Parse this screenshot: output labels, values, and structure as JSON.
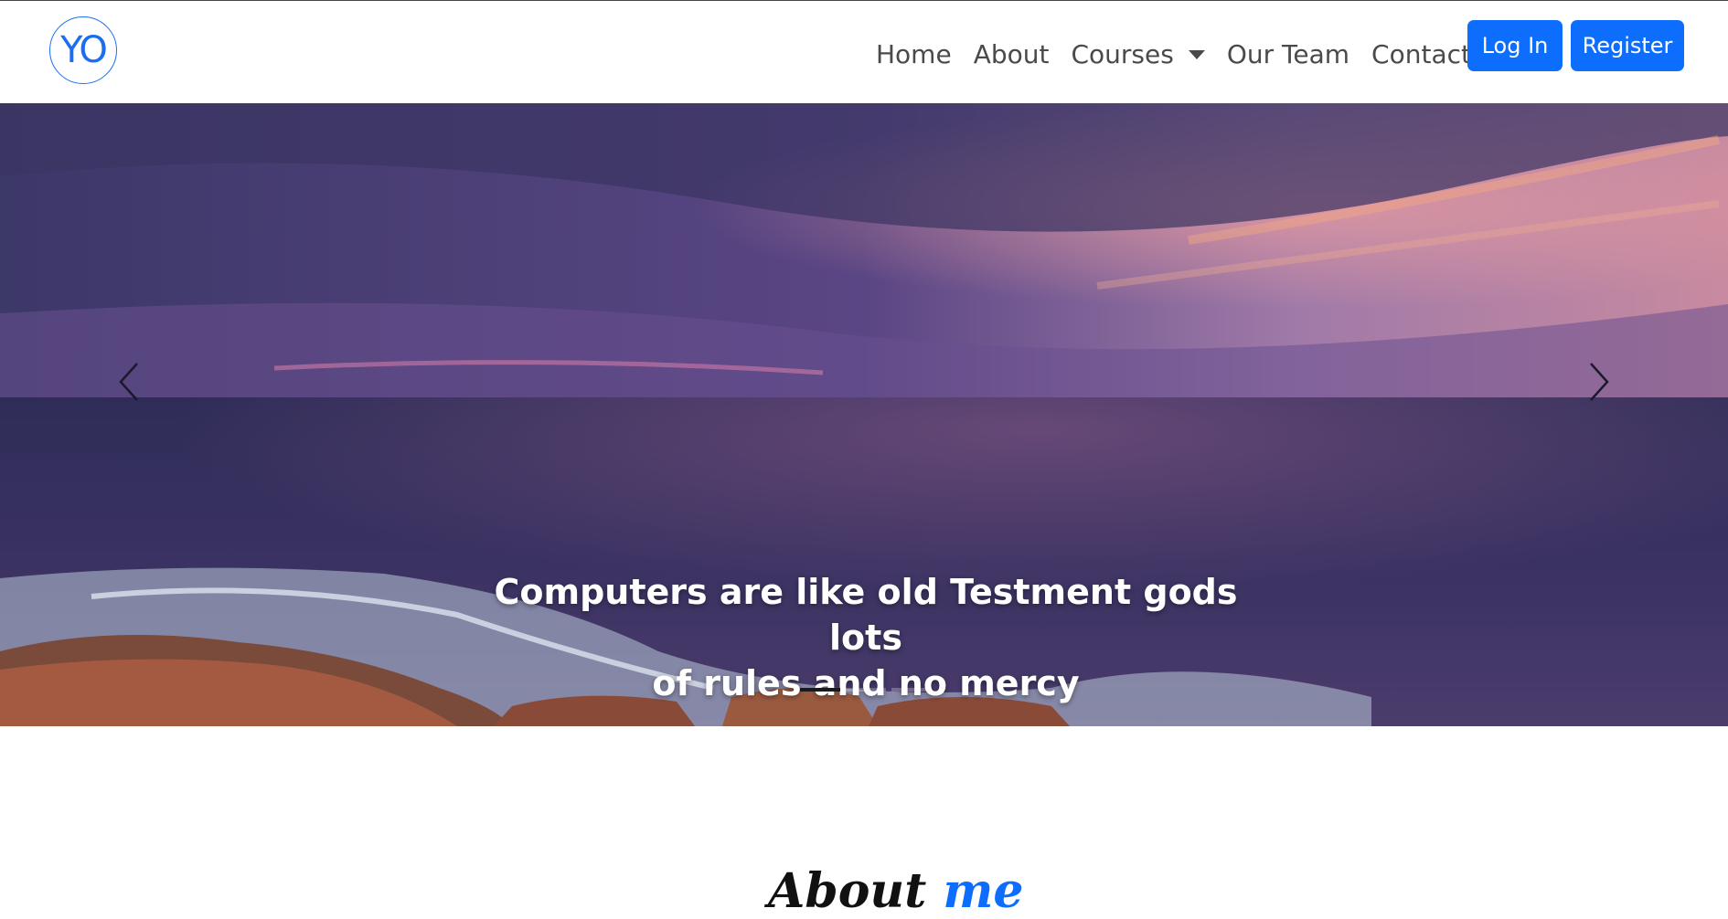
{
  "logo": {
    "text": "YO"
  },
  "nav": {
    "items": [
      {
        "label": "Home"
      },
      {
        "label": "About"
      },
      {
        "label": "Courses"
      },
      {
        "label": "Our Team"
      },
      {
        "label": "Contact"
      }
    ],
    "login_label": "Log In",
    "register_label": "Register"
  },
  "hero": {
    "caption_line1": "Computers are like old Testment gods lots",
    "caption_line2": "of rules and no mercy",
    "prev_icon": "chevron-left-icon",
    "next_icon": "chevron-right-icon",
    "slides_count": 3,
    "active_slide": 0
  },
  "about": {
    "heading_part1": "About",
    "heading_part2": "me"
  },
  "colors": {
    "primary": "#0d6efd",
    "nav_text": "#4a4a4a",
    "caption_text": "#ffffff"
  }
}
